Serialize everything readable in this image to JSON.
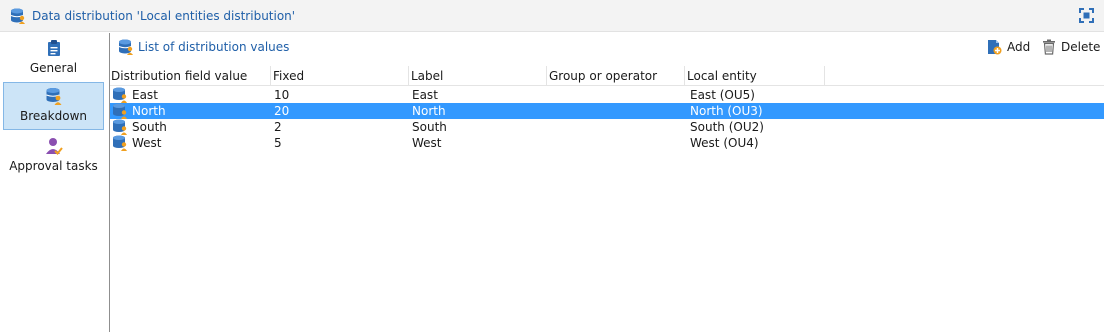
{
  "window": {
    "title": "Data distribution 'Local entities distribution'",
    "icon": "database-icon",
    "maximize_icon": "maximize-icon"
  },
  "sidebar": {
    "items": [
      {
        "label": "General",
        "icon": "clipboard-icon",
        "selected": false
      },
      {
        "label": "Breakdown",
        "icon": "database-user-icon",
        "selected": true
      },
      {
        "label": "Approval tasks",
        "icon": "user-check-icon",
        "selected": false
      }
    ]
  },
  "toolbar": {
    "list_title": "List of distribution values",
    "add_label": "Add",
    "delete_label": "Delete"
  },
  "table": {
    "columns": [
      "Distribution field value",
      "Fixed",
      "Label",
      "Group or operator",
      "Local entity"
    ],
    "rows": [
      {
        "value": "East",
        "fixed": "10",
        "label": "East",
        "group": "",
        "entity": "East (OU5)",
        "selected": false
      },
      {
        "value": "North",
        "fixed": "20",
        "label": "North",
        "group": "",
        "entity": "North (OU3)",
        "selected": true
      },
      {
        "value": "South",
        "fixed": "2",
        "label": "South",
        "group": "",
        "entity": "South (OU2)",
        "selected": false
      },
      {
        "value": "West",
        "fixed": "5",
        "label": "West",
        "group": "",
        "entity": "West (OU4)",
        "selected": false
      }
    ]
  },
  "colors": {
    "accent": "#1f5fa8",
    "selection": "#3399ff",
    "sidebar_selection": "#cce4f7",
    "icon_orange": "#f0a020"
  }
}
